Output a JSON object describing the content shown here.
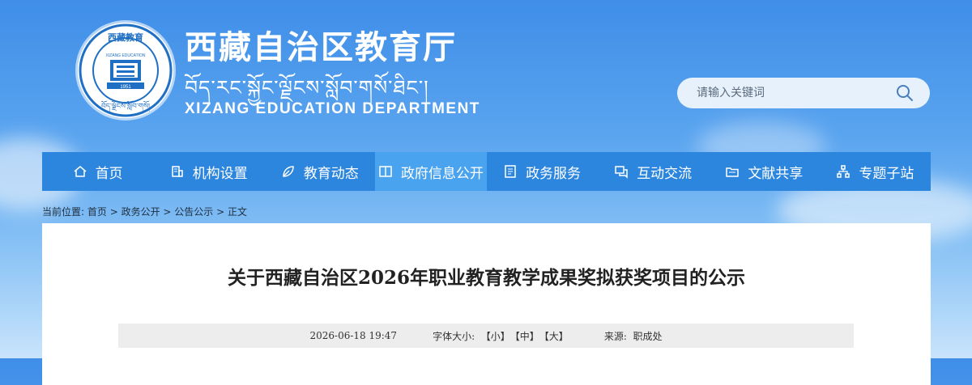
{
  "header": {
    "title_cn": "西藏自治区教育厅",
    "title_tibetan": "བོད་རང་སྐྱོང་ལྗོངས་སློབ་གསོ་ཐིང་།",
    "title_en": "XIZANG EDUCATION DEPARTMENT",
    "emblem": {
      "top_text": "西藏教育",
      "inner_text": "XIZANG EDUCATION",
      "year": "1951",
      "bottom_text": "བོད་ལྗོངས་སློབ་གསོ།"
    }
  },
  "search": {
    "placeholder": "请输入关键词",
    "icon": "search-icon"
  },
  "nav": {
    "items": [
      {
        "label": "首页",
        "icon": "home-icon"
      },
      {
        "label": "机构设置",
        "icon": "building-icon"
      },
      {
        "label": "教育动态",
        "icon": "leaf-icon"
      },
      {
        "label": "政府信息公开",
        "icon": "book-icon"
      },
      {
        "label": "政务服务",
        "icon": "document-icon"
      },
      {
        "label": "互动交流",
        "icon": "chat-icon"
      },
      {
        "label": "文献共享",
        "icon": "folder-icon"
      },
      {
        "label": "专题子站",
        "icon": "sitemap-icon"
      }
    ],
    "active_index": 3
  },
  "breadcrumb": {
    "prefix": "当前位置:",
    "items": [
      "首页",
      "政务公开",
      "公告公示",
      "正文"
    ],
    "separator": " > "
  },
  "article": {
    "title": "关于西藏自治区2026年职业教育教学成果奖拟获奖项目的公示",
    "date": "2026-06-18 19:47",
    "font_size_label": "字体大小:",
    "font_small": "【小】",
    "font_medium": "【中】",
    "font_large": "【大】",
    "source_label": "来源:",
    "source": "职成处"
  },
  "colors": {
    "nav_bg": "#2d86de",
    "nav_active": "#4aa3ee",
    "emblem_blue": "#1f6fc4"
  }
}
